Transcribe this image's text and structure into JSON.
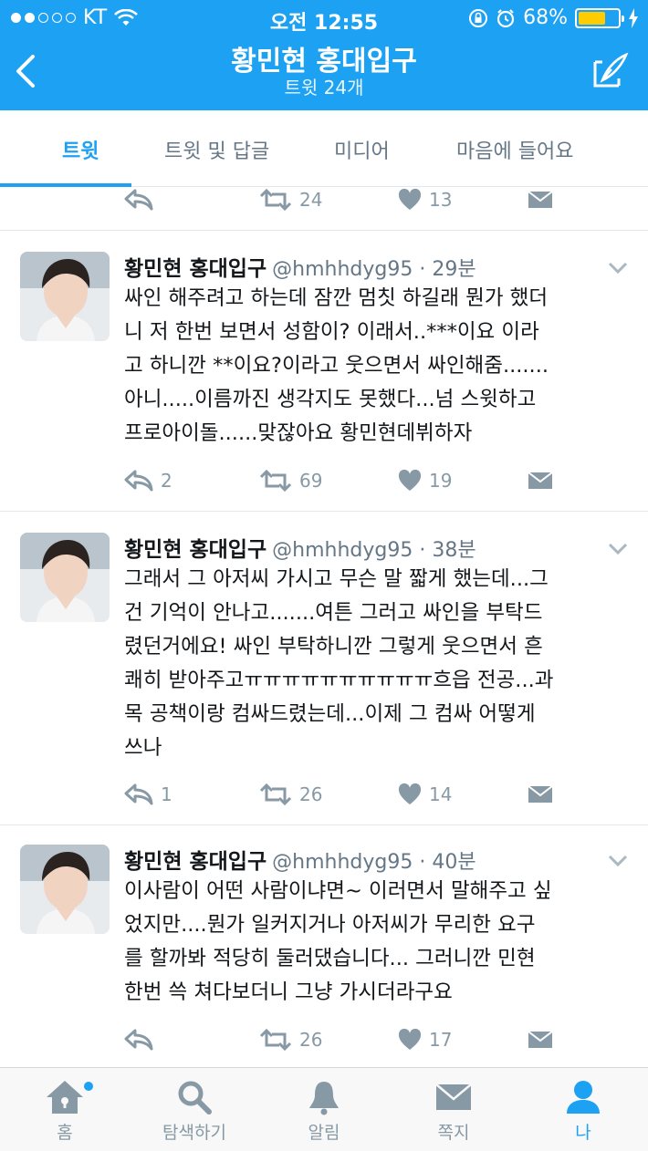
{
  "status_bar": {
    "carrier": "KT",
    "time": "오전 12:55",
    "battery": "68%",
    "battery_level": 0.68
  },
  "nav": {
    "title": "황민현 홍대입구",
    "subtitle": "트윗 24개"
  },
  "tabs": [
    {
      "label": "트윗",
      "active": true
    },
    {
      "label": "트윗 및 답글"
    },
    {
      "label": "미디어"
    },
    {
      "label": "마음에 들어요"
    }
  ],
  "partial_tweet": {
    "replies": "",
    "retweets": "24",
    "likes": "13"
  },
  "tweets": [
    {
      "name": "황민현 홍대입구",
      "handle": "@hmhhdyg95 · 29분",
      "text": "싸인 해주려고 하는데 잠깐 멈칫 하길래 뭔가 했더니 저 한번 보면서 성함이? 이래서..***이요 이라고 하니깐 **이요?이라고 웃으면서 싸인해줌.......아니.....이름까진 생각지도 못했다...넘 스윗하고 프로아이돌......맞잖아요 황민현데뷔하자",
      "lines": [
        "싸인 해주려고 하는데 잠깐 멈칫 하길래 뭔가 했더",
        "니 저 한번 보면서 성함이? 이래서..***이요 이라",
        "고 하니깐 **이요?이라고 웃으면서 싸인해줌.......",
        "아니.....이름까진 생각지도 못했다...넘 스윗하고",
        "프로아이돌......맞잖아요 황민현데뷔하자"
      ],
      "replies": "2",
      "retweets": "69",
      "likes": "19"
    },
    {
      "name": "황민현 홍대입구",
      "handle": "@hmhhdyg95 · 38분",
      "lines": [
        "그래서 그 아저씨 가시고 무슨 말 짧게 했는데...그",
        "건 기억이 안나고.......여튼 그러고 싸인을 부탁드",
        "렸던거에요! 싸인 부탁하니깐 그렇게 웃으면서 흔",
        "쾌히 받아주고ㅠㅠㅠㅠㅠㅠㅠㅠㅠㅠ흐읍 전공...과",
        "목 공책이랑 컴싸드렸는데...이제 그 컴싸 어떻게",
        "쓰나"
      ],
      "replies": "1",
      "retweets": "26",
      "likes": "14"
    },
    {
      "name": "황민현 홍대입구",
      "handle": "@hmhhdyg95 · 40분",
      "lines": [
        "이사람이 어떤 사람이냐면~ 이러면서 말해주고 싶",
        "었지만....뭔가 일커지거나 아저씨가 무리한 요구",
        "를 할까봐 적당히 둘러댔습니다... 그러니깐 민현",
        "한번 쓱 쳐다보더니 그냥 가시더라구요"
      ],
      "replies": "",
      "retweets": "26",
      "likes": "17"
    }
  ],
  "tabbar": [
    {
      "label": "홈",
      "icon": "home-icon"
    },
    {
      "label": "탐색하기",
      "icon": "search-icon"
    },
    {
      "label": "알림",
      "icon": "bell-icon"
    },
    {
      "label": "쪽지",
      "icon": "envelope-icon"
    },
    {
      "label": "나",
      "icon": "person-icon",
      "active": true
    }
  ],
  "colors": {
    "accent": "#1da1f2",
    "muted": "#8899a6",
    "battery_fill": "#ffcc00"
  }
}
